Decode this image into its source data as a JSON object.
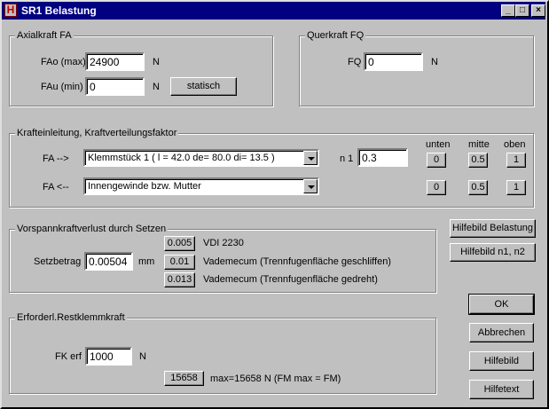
{
  "window": {
    "title": "SR1 Belastung",
    "icon": "app-icon",
    "icon_glyph": "H"
  },
  "caption_buttons": {
    "minimize": "_",
    "maximize": "□",
    "close": "×"
  },
  "axial": {
    "title": "Axialkraft FA",
    "fao_label": "FAo (max)",
    "fao_value": "24900",
    "fao_unit": "N",
    "fau_label": "FAu (min)",
    "fau_value": "0",
    "fau_unit": "N",
    "statisch_button": "statisch"
  },
  "quer": {
    "title": "Querkraft FQ",
    "fq_label": "FQ",
    "fq_value": "0",
    "fq_unit": "N"
  },
  "kraft": {
    "title": "Krafteinleitung, Kraftverteilungsfaktor",
    "col_unten": "unten",
    "col_mitte": "mitte",
    "col_oben": "oben",
    "row1_label": "FA  -->",
    "row1_value": "Klemmstück 1  ( l = 42.0 de= 80.0 di= 13.5 )",
    "n1_label": "n 1",
    "n1_value": "0.3",
    "row2_label": "FA  <--",
    "row2_value": "Innengewinde bzw. Mutter",
    "btn_unten": "0",
    "btn_mitte": "0.5",
    "btn_oben": "1"
  },
  "vorspann": {
    "title": "Vorspannkraftverlust durch Setzen",
    "setzbetrag_label": "Setzbetrag",
    "setzbetrag_value": "0.00504",
    "unit": "mm",
    "opt1_btn": "0.005",
    "opt1_text": "VDI 2230",
    "opt2_btn": "0.01",
    "opt2_text": "Vademecum (Trennfugenfläche geschliffen)",
    "opt3_btn": "0.013",
    "opt3_text": "Vademecum (Trennfugenfläche gedreht)"
  },
  "rest": {
    "title": "Erforderl.Restklemmkraft",
    "fk_label": "FK erf",
    "fk_value": "1000",
    "fk_unit": "N",
    "max_btn": "15658",
    "max_text": "max=15658 N  (FM max = FM)"
  },
  "side_buttons": {
    "hilfebild_belastung": "Hilfebild Belastung",
    "hilfebild_n1n2": "Hilfebild n1, n2",
    "ok": "OK",
    "abbrechen": "Abbrechen",
    "hilfebild": "Hilfebild",
    "hilfetext": "Hilfetext"
  }
}
